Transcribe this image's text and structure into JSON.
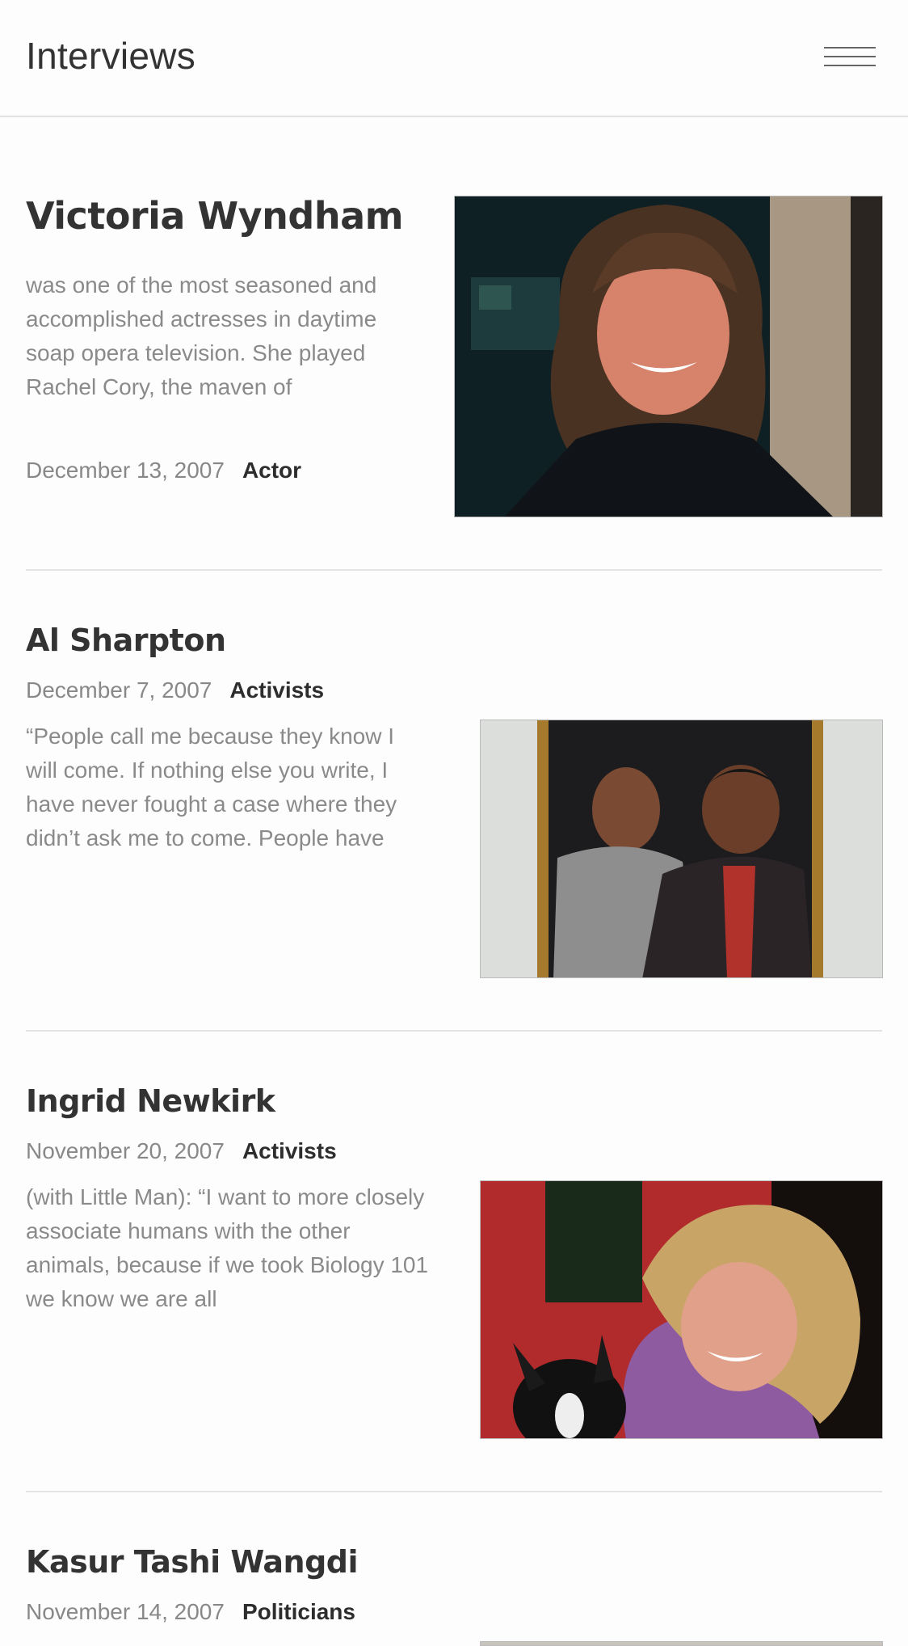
{
  "header": {
    "title": "Interviews",
    "menu_icon": "hamburger-menu-icon"
  },
  "posts": [
    {
      "name": "Victoria Wyndham",
      "excerpt": "was one of the most seasoned and accomplished actresses in daytime soap opera television. She played Rachel Cory, the maven of",
      "date": "December 13, 2007",
      "category": "Actor"
    },
    {
      "name": "Al Sharpton",
      "date": "December 7, 2007",
      "category": "Activists",
      "excerpt": "“People call me because they know I will come. If nothing else you write, I have never fought a case where they didn’t ask me to come. People have"
    },
    {
      "name": "Ingrid Newkirk",
      "date": "November 20, 2007",
      "category": "Activists",
      "excerpt": "(with Little Man): “I want to more closely associate humans with the other animals, because if we took Biology 101 we know we are all"
    },
    {
      "name": "Kasur Tashi Wangdi",
      "date": "November 14, 2007",
      "category": "Politicians"
    }
  ]
}
